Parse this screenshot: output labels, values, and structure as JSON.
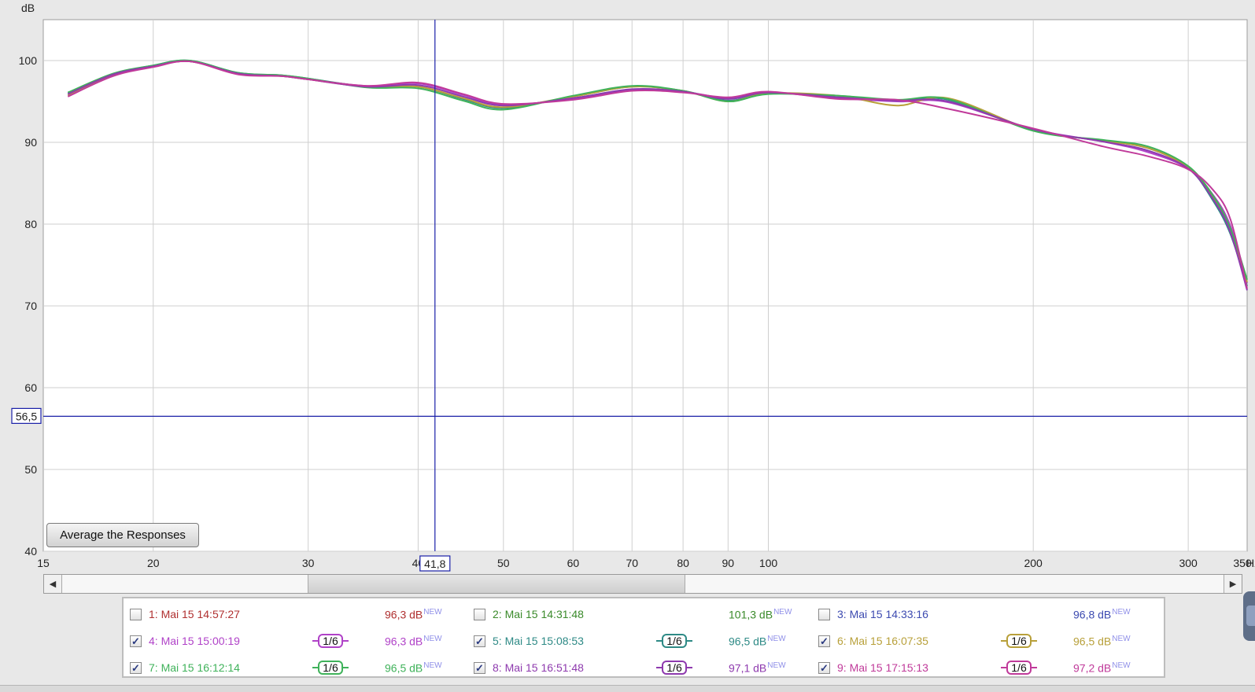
{
  "chart_data": {
    "type": "line",
    "x_scale": "log",
    "xlim": [
      15,
      350
    ],
    "ylim": [
      40,
      105
    ],
    "ylabel": "dB",
    "xlabel": "Hz",
    "grid": true,
    "x_ticks": [
      15,
      20,
      30,
      40,
      50,
      60,
      70,
      80,
      90,
      100,
      200,
      300,
      350
    ],
    "y_ticks": [
      40,
      50,
      60,
      70,
      80,
      90,
      100
    ],
    "cursor": {
      "x": 41.8,
      "y": 56.5,
      "x_label": "41,8",
      "y_label": "56,5"
    },
    "series": [
      {
        "name": "4: Mai 15 15:00:19",
        "color": "#b042c8",
        "x": [
          16,
          18,
          20,
          22,
          25,
          28,
          30,
          35,
          40,
          45,
          50,
          60,
          70,
          80,
          90,
          100,
          120,
          140,
          160,
          200,
          240,
          270,
          300,
          320,
          335,
          350
        ],
        "y": [
          95.8,
          98.2,
          99.3,
          99.9,
          98.4,
          98.1,
          97.7,
          96.9,
          97.2,
          95.8,
          94.6,
          95.3,
          96.4,
          96.2,
          95.4,
          96.1,
          95.4,
          95.0,
          94.9,
          91.6,
          90.1,
          88.8,
          86.8,
          83.6,
          79.8,
          72.8
        ]
      },
      {
        "name": "5: Mai 15 15:08:53",
        "color": "#2e8a86",
        "x": [
          16,
          18,
          20,
          22,
          25,
          28,
          30,
          35,
          40,
          45,
          50,
          60,
          70,
          80,
          90,
          100,
          120,
          140,
          160,
          200,
          240,
          270,
          300,
          320,
          335,
          350
        ],
        "y": [
          96.0,
          98.3,
          99.4,
          100.0,
          98.5,
          98.2,
          97.8,
          96.8,
          96.8,
          95.3,
          94.2,
          95.6,
          96.8,
          96.3,
          95.1,
          96.0,
          95.7,
          95.1,
          95.2,
          91.5,
          90.2,
          89.3,
          86.9,
          82.9,
          78.8,
          72.4
        ]
      },
      {
        "name": "6: Mai 15 16:07:35",
        "color": "#b8a03a",
        "x": [
          16,
          18,
          20,
          22,
          25,
          28,
          30,
          35,
          40,
          45,
          50,
          60,
          70,
          80,
          90,
          100,
          120,
          140,
          160,
          200,
          240,
          270,
          300,
          320,
          335,
          350
        ],
        "y": [
          95.7,
          98.2,
          99.3,
          99.9,
          98.4,
          98.1,
          97.7,
          96.8,
          96.8,
          95.4,
          94.3,
          95.6,
          96.8,
          96.3,
          95.0,
          96.0,
          95.7,
          94.5,
          95.4,
          91.5,
          90.2,
          89.3,
          86.9,
          83.3,
          79.2,
          72.9
        ]
      },
      {
        "name": "7: Mai 15 16:12:14",
        "color": "#3fb25a",
        "x": [
          16,
          18,
          20,
          22,
          25,
          28,
          30,
          35,
          40,
          45,
          50,
          60,
          70,
          80,
          90,
          100,
          120,
          140,
          160,
          200,
          240,
          270,
          300,
          320,
          335,
          350
        ],
        "y": [
          96.1,
          98.4,
          99.4,
          100.0,
          98.5,
          98.2,
          97.8,
          96.7,
          96.6,
          95.1,
          94.0,
          95.7,
          96.9,
          96.3,
          95.0,
          95.9,
          95.7,
          95.2,
          95.3,
          91.4,
          90.3,
          89.5,
          87.1,
          83.5,
          79.5,
          73.2
        ]
      },
      {
        "name": "8: Mai 15 16:51:48",
        "color": "#8e3aae",
        "x": [
          16,
          18,
          20,
          22,
          25,
          28,
          30,
          35,
          40,
          45,
          50,
          60,
          70,
          80,
          90,
          100,
          120,
          140,
          160,
          200,
          240,
          270,
          300,
          320,
          335,
          350
        ],
        "y": [
          95.9,
          98.3,
          99.3,
          99.9,
          98.4,
          98.1,
          97.7,
          96.8,
          97.0,
          95.6,
          94.5,
          95.4,
          96.5,
          96.2,
          95.3,
          96.1,
          95.5,
          95.1,
          95.0,
          91.6,
          90.1,
          89.0,
          86.8,
          83.1,
          79.0,
          71.9
        ]
      },
      {
        "name": "9: Mai 15 17:15:13",
        "color": "#c03a9a",
        "x": [
          16,
          18,
          20,
          22,
          25,
          28,
          30,
          35,
          40,
          45,
          50,
          60,
          70,
          80,
          90,
          100,
          120,
          140,
          160,
          200,
          240,
          270,
          300,
          320,
          335,
          350
        ],
        "y": [
          95.6,
          98.1,
          99.2,
          99.9,
          98.3,
          98.1,
          97.7,
          96.9,
          97.3,
          95.9,
          94.7,
          95.2,
          96.3,
          96.1,
          95.5,
          96.2,
          95.3,
          95.2,
          94.1,
          91.7,
          89.5,
          88.3,
          86.7,
          84.2,
          80.6,
          72.1
        ]
      }
    ]
  },
  "average_button": {
    "label": "Average the Responses"
  },
  "legend": {
    "items": [
      {
        "label": "1: Mai 15 14:57:27",
        "level": "96,3 dB",
        "new_tag": "NEW",
        "checked": false,
        "smoothing": "",
        "color": "#b03030"
      },
      {
        "label": "2: Mai 15 14:31:48",
        "level": "101,3 dB",
        "new_tag": "NEW",
        "checked": false,
        "smoothing": "",
        "color": "#3a8a2a"
      },
      {
        "label": "3: Mai 15 14:33:16",
        "level": "96,8 dB",
        "new_tag": "NEW",
        "checked": false,
        "smoothing": "",
        "color": "#3c4ab0"
      },
      {
        "label": "4: Mai 15 15:00:19",
        "level": "96,3 dB",
        "new_tag": "NEW",
        "checked": true,
        "smoothing": "1/6",
        "color": "#b042c8"
      },
      {
        "label": "5: Mai 15 15:08:53",
        "level": "96,5 dB",
        "new_tag": "NEW",
        "checked": true,
        "smoothing": "1/6",
        "color": "#2e8a86"
      },
      {
        "label": "6: Mai 15 16:07:35",
        "level": "96,5 dB",
        "new_tag": "NEW",
        "checked": true,
        "smoothing": "1/6",
        "color": "#b8a03a"
      },
      {
        "label": "7: Mai 15 16:12:14",
        "level": "96,5 dB",
        "new_tag": "NEW",
        "checked": true,
        "smoothing": "1/6",
        "color": "#3fb25a"
      },
      {
        "label": "8: Mai 15 16:51:48",
        "level": "97,1 dB",
        "new_tag": "NEW",
        "checked": true,
        "smoothing": "1/6",
        "color": "#8e3aae"
      },
      {
        "label": "9: Mai 15 17:15:13",
        "level": "97,2 dB",
        "new_tag": "NEW",
        "checked": true,
        "smoothing": "1/6",
        "color": "#c03a9a"
      }
    ]
  },
  "scrollbar": {
    "left_arrow": "◀",
    "right_arrow": "▶"
  },
  "check_glyph": "✓"
}
